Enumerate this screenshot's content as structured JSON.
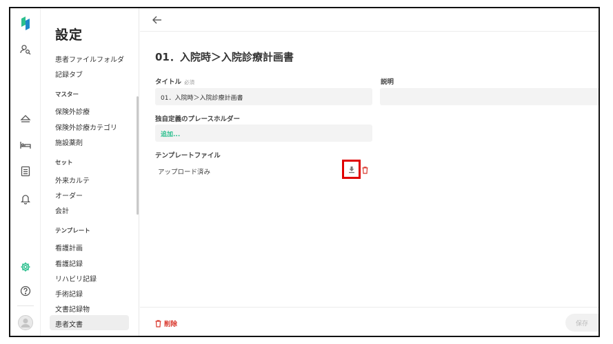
{
  "nav": {
    "title": "設定",
    "items_top": [
      "患者ファイルフォルダ",
      "記録タブ"
    ],
    "section_master": "マスター",
    "items_master": [
      "保険外診療",
      "保険外診療カテゴリ",
      "施設薬剤"
    ],
    "section_set": "セット",
    "items_set": [
      "外来カルテ",
      "オーダー",
      "会計"
    ],
    "section_template": "テンプレート",
    "items_template": [
      "看護計画",
      "看護記録",
      "リハビリ記録",
      "手術記録",
      "文書記録物",
      "患者文書"
    ],
    "active_item": "患者文書"
  },
  "main": {
    "title": "01．入院時＞入院診療計画書",
    "title_label": "タイトル",
    "required_mark": "必須",
    "title_value": "01．入院時＞入院診療計画書",
    "description_label": "説明",
    "description_value": "",
    "placeholder_label": "独自定義のプレースホルダー",
    "add_link": "追加...",
    "template_file_label": "テンプレートファイル",
    "upload_status": "アップロード済み",
    "delete_label": "削除",
    "save_label": "保存"
  },
  "colors": {
    "accent_green": "#2bbf8e",
    "danger_red": "#d9362b",
    "highlight_box": "#e00000"
  },
  "icons": {
    "rail": [
      "logo-icon",
      "user-search-icon",
      "eject-icon",
      "bed-icon",
      "document-list-icon",
      "bell-icon",
      "gear-icon",
      "help-icon",
      "avatar-icon"
    ],
    "back": "arrow-left-icon",
    "download": "download-icon",
    "trash": "trash-icon"
  }
}
